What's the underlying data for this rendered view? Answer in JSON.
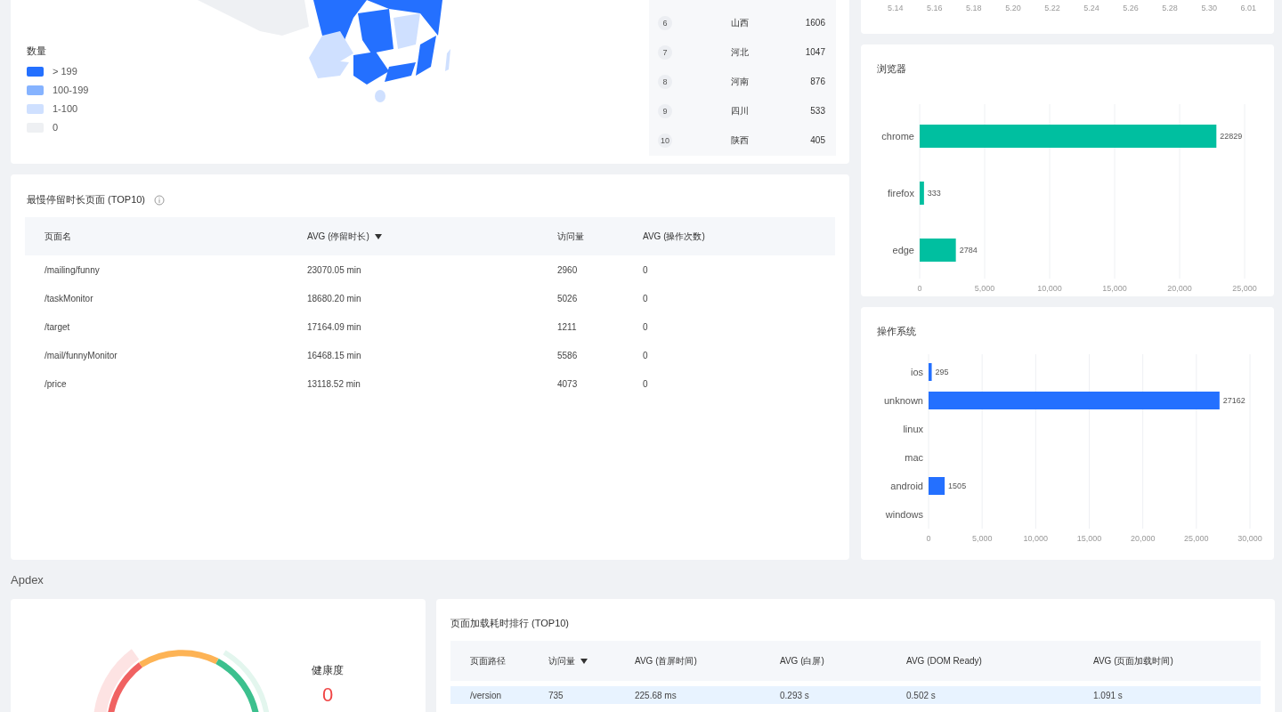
{
  "map_card": {
    "legend_title": "数量",
    "legend": [
      {
        "label": "> 199",
        "color": "#2470ff"
      },
      {
        "label": "100-199",
        "color": "#86b3ff"
      },
      {
        "label": "1-100",
        "color": "#cfe0ff"
      },
      {
        "label": "0",
        "color": "#eef0f3"
      }
    ],
    "ranking": [
      {
        "rank": "6",
        "region": "山西",
        "count": "1606"
      },
      {
        "rank": "7",
        "region": "河北",
        "count": "1047"
      },
      {
        "rank": "8",
        "region": "河南",
        "count": "876"
      },
      {
        "rank": "9",
        "region": "四川",
        "count": "533"
      },
      {
        "rank": "10",
        "region": "陕西",
        "count": "405"
      }
    ]
  },
  "trend_card": {
    "x_labels": [
      "5.14",
      "5.16",
      "5.18",
      "5.20",
      "5.22",
      "5.24",
      "5.26",
      "5.28",
      "5.30",
      "6.01"
    ]
  },
  "browser_card": {
    "title": "浏览器",
    "chart_data": {
      "type": "bar",
      "orientation": "horizontal",
      "categories": [
        "chrome",
        "firefox",
        "edge"
      ],
      "grid": true,
      "series": [
        {
          "color": "#00bfa0",
          "values": [
            22829,
            333,
            2784
          ]
        }
      ],
      "xlim": [
        0,
        25000
      ],
      "xticks": [
        {
          "value": 0,
          "label": "0"
        },
        {
          "value": 5000,
          "label": "5,000"
        },
        {
          "value": 10000,
          "label": "10,000"
        },
        {
          "value": 15000,
          "label": "15,000"
        },
        {
          "value": 20000,
          "label": "20,000"
        },
        {
          "value": 25000,
          "label": "25,000"
        }
      ],
      "data_labels": true
    }
  },
  "os_card": {
    "title": "操作系统",
    "chart_data": {
      "type": "bar",
      "orientation": "horizontal",
      "categories": [
        "ios",
        "unknown",
        "linux",
        "mac",
        "android",
        "windows"
      ],
      "grid": true,
      "series": [
        {
          "color": "#2470ff",
          "values": [
            295,
            27162,
            null,
            null,
            1505,
            null
          ]
        }
      ],
      "xlim": [
        0,
        30000
      ],
      "xticks": [
        {
          "value": 0,
          "label": "0"
        },
        {
          "value": 5000,
          "label": "5,000"
        },
        {
          "value": 10000,
          "label": "10,000"
        },
        {
          "value": 15000,
          "label": "15,000"
        },
        {
          "value": 20000,
          "label": "20,000"
        },
        {
          "value": 25000,
          "label": "25,000"
        },
        {
          "value": 30000,
          "label": "30,000"
        }
      ],
      "data_labels": true
    }
  },
  "slow_pages": {
    "title": "最慢停留时长页面 (TOP10)",
    "columns": [
      {
        "label": "页面名",
        "sorted": false
      },
      {
        "label": "AVG (停留时长)",
        "sorted": true
      },
      {
        "label": "访问量",
        "sorted": false
      },
      {
        "label": "AVG (操作次数)",
        "sorted": false
      }
    ],
    "rows": [
      [
        "/mailing/funny",
        "23070.05 min",
        "2960",
        "0"
      ],
      [
        "/taskMonitor",
        "18680.20 min",
        "5026",
        "0"
      ],
      [
        "/target",
        "17164.09 min",
        "1211",
        "0"
      ],
      [
        "/mail/funnyMonitor",
        "16468.15 min",
        "5586",
        "0"
      ],
      [
        "/price",
        "13118.52 min",
        "4073",
        "0"
      ]
    ]
  },
  "apdex": {
    "section_title": "Apdex",
    "gauge_label": "健康度",
    "gauge_value": "0"
  },
  "load_ranking": {
    "title": "页面加载耗时排行 (TOP10)",
    "columns": [
      {
        "label": "页面路径",
        "sorted": false
      },
      {
        "label": "访问量",
        "sorted": true
      },
      {
        "label": "AVG (首屏时间)",
        "sorted": false
      },
      {
        "label": "AVG (白屏)",
        "sorted": false
      },
      {
        "label": "AVG (DOM Ready)",
        "sorted": false
      },
      {
        "label": "AVG (页面加载时间)",
        "sorted": false
      }
    ],
    "rows": [
      {
        "cells": [
          "/version",
          "735",
          "225.68 ms",
          "0.293 s",
          "0.502 s",
          "1.091 s"
        ],
        "selected": true
      }
    ]
  }
}
